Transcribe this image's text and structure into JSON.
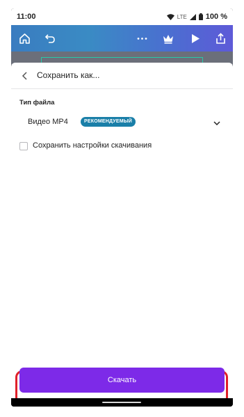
{
  "status": {
    "time": "11:00",
    "network": "LTE",
    "battery": "100 %"
  },
  "toolbar": {
    "icons": [
      "home-icon",
      "undo-icon",
      "more-icon",
      "crown-icon",
      "play-icon",
      "share-icon"
    ]
  },
  "sheet": {
    "title": "Сохранить как...",
    "file_type_label": "Тип файла",
    "file_type_value": "Видео MP4",
    "badge": "РЕКОМЕНДУЕМЫЙ",
    "save_settings_label": "Сохранить настройки скачивания",
    "save_settings_checked": false
  },
  "download_button": "Скачать",
  "colors": {
    "accent": "#7d2ae8",
    "badge": "#1a7fa8",
    "highlight": "#e0202a"
  }
}
